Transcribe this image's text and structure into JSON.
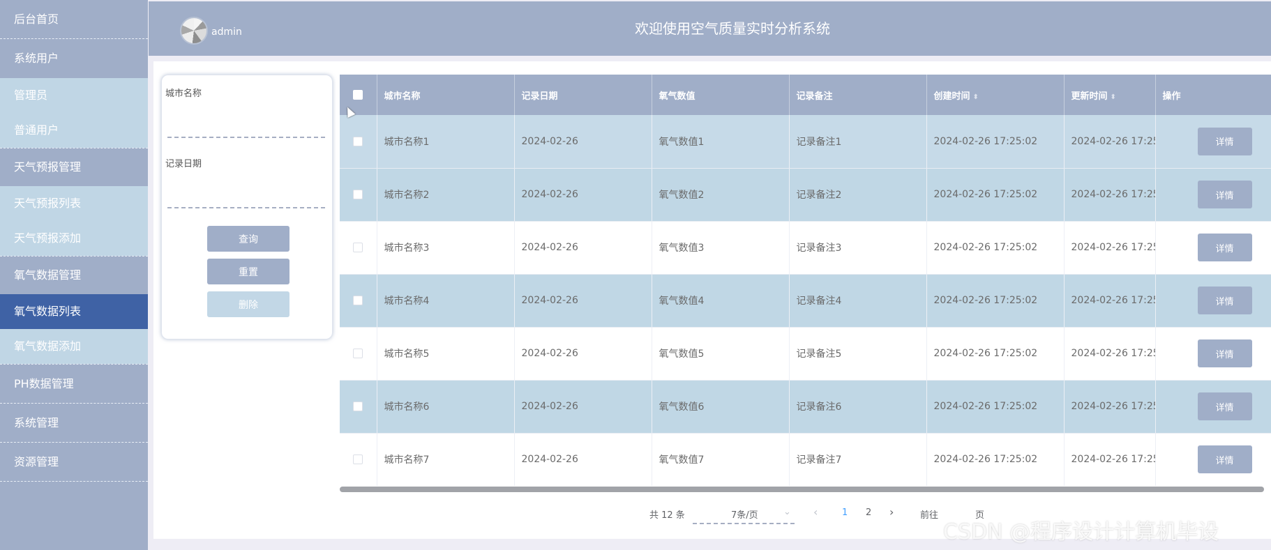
{
  "sidebar": {
    "items": [
      {
        "label": "后台首页"
      },
      {
        "label": "系统用户",
        "children": [
          {
            "label": "管理员"
          },
          {
            "label": "普通用户"
          }
        ]
      },
      {
        "label": "天气预报管理",
        "children": [
          {
            "label": "天气预报列表"
          },
          {
            "label": "天气预报添加"
          }
        ]
      },
      {
        "label": "氧气数据管理",
        "children": [
          {
            "label": "氧气数据列表",
            "active": true
          },
          {
            "label": "氧气数据添加"
          }
        ]
      },
      {
        "label": "PH数据管理"
      },
      {
        "label": "系统管理"
      },
      {
        "label": "资源管理"
      }
    ]
  },
  "header": {
    "username": "admin",
    "title": "欢迎使用空气质量实时分析系统"
  },
  "search": {
    "city_label": "城市名称",
    "date_label": "记录日期",
    "city_value": "",
    "date_value": "",
    "query_btn": "查询",
    "reset_btn": "重置",
    "delete_btn": "删除"
  },
  "table": {
    "columns": [
      "城市名称",
      "记录日期",
      "氧气数值",
      "记录备注",
      "创建时间",
      "更新时间",
      "操作"
    ],
    "sort_icon": "⬍",
    "detail_label": "详情",
    "rows": [
      {
        "city": "城市名称1",
        "date": "2024-02-26",
        "value": "氧气数值1",
        "note": "记录备注1",
        "created": "2024-02-26 17:25:02",
        "updated": "2024-02-26 17:25:0"
      },
      {
        "city": "城市名称2",
        "date": "2024-02-26",
        "value": "氧气数值2",
        "note": "记录备注2",
        "created": "2024-02-26 17:25:02",
        "updated": "2024-02-26 17:25:0"
      },
      {
        "city": "城市名称3",
        "date": "2024-02-26",
        "value": "氧气数值3",
        "note": "记录备注3",
        "created": "2024-02-26 17:25:02",
        "updated": "2024-02-26 17:25:0"
      },
      {
        "city": "城市名称4",
        "date": "2024-02-26",
        "value": "氧气数值4",
        "note": "记录备注4",
        "created": "2024-02-26 17:25:02",
        "updated": "2024-02-26 17:25:0"
      },
      {
        "city": "城市名称5",
        "date": "2024-02-26",
        "value": "氧气数值5",
        "note": "记录备注5",
        "created": "2024-02-26 17:25:02",
        "updated": "2024-02-26 17:25:0"
      },
      {
        "city": "城市名称6",
        "date": "2024-02-26",
        "value": "氧气数值6",
        "note": "记录备注6",
        "created": "2024-02-26 17:25:02",
        "updated": "2024-02-26 17:25:0"
      },
      {
        "city": "城市名称7",
        "date": "2024-02-26",
        "value": "氧气数值7",
        "note": "记录备注7",
        "created": "2024-02-26 17:25:02",
        "updated": "2024-02-26 17:25:0"
      }
    ]
  },
  "pagination": {
    "total_text": "共 12 条",
    "page_size": "7条/页",
    "prev": "‹",
    "next": "›",
    "pages": [
      "1",
      "2"
    ],
    "current_page": "1",
    "goto_prefix": "前往",
    "goto_suffix": "页"
  },
  "watermark": "CSDN @程序设计计算机毕设",
  "colors": {
    "primary": "#a0aec8",
    "row_alt": "#c0d7e5",
    "menu_active": "#3f62a5",
    "page_active": "#409eff"
  }
}
